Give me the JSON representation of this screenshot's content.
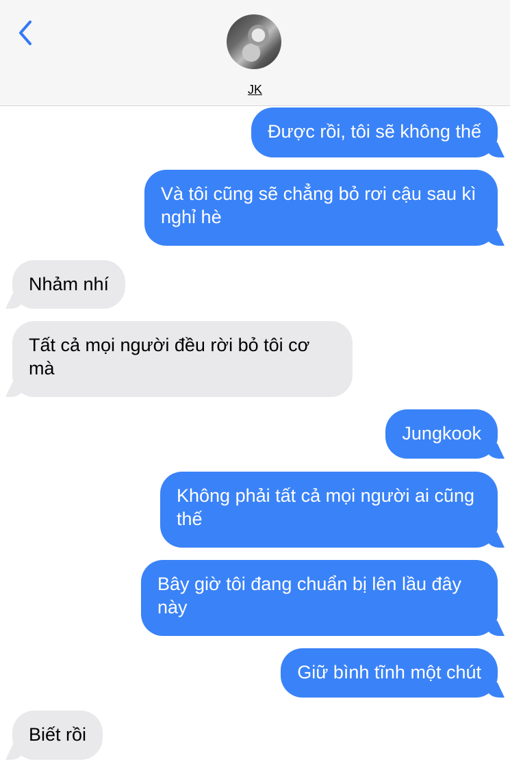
{
  "header": {
    "contact_name": "JK"
  },
  "messages": [
    {
      "side": "sent",
      "text": "Được rồi, tôi sẽ không thế"
    },
    {
      "side": "sent",
      "text": "Và tôi cũng sẽ chẳng bỏ rơi cậu sau kì nghỉ hè"
    },
    {
      "side": "received",
      "text": "Nhảm nhí"
    },
    {
      "side": "received",
      "text": "Tất cả mọi người đều rời bỏ tôi cơ mà"
    },
    {
      "side": "sent",
      "text": "Jungkook"
    },
    {
      "side": "sent",
      "text": "Không phải tất cả mọi người ai cũng thế"
    },
    {
      "side": "sent",
      "text": "Bây giờ tôi đang chuẩn bị lên lầu đây này"
    },
    {
      "side": "sent",
      "text": "Giữ bình tĩnh một chút"
    },
    {
      "side": "received",
      "text": "Biết rồi"
    }
  ],
  "colors": {
    "sent_bubble": "#3a82f7",
    "received_bubble": "#e9e9eb",
    "accent": "#3478f6"
  },
  "icons": {
    "back": "chevron-left-icon"
  }
}
